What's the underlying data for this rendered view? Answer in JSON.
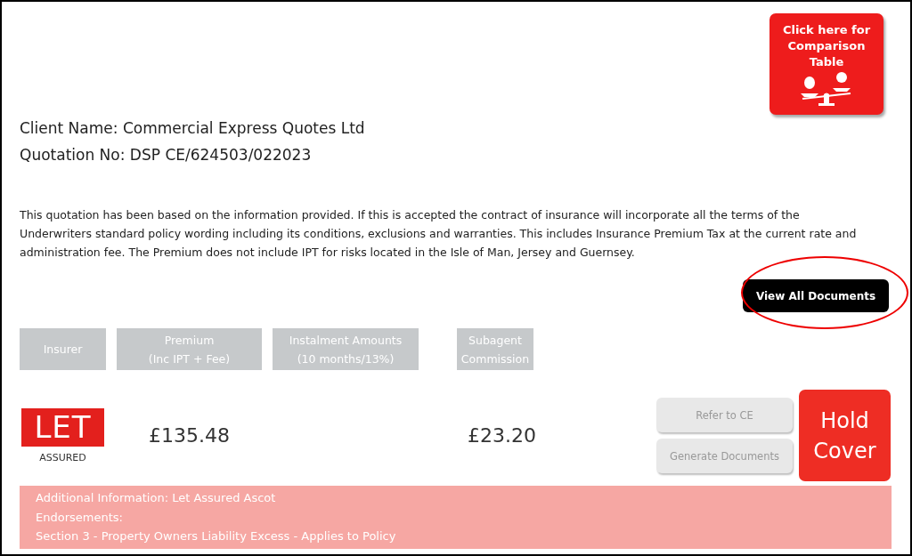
{
  "comparison_button": {
    "label": "Click here for Comparison Table"
  },
  "client_name": "Client Name: Commercial Express Quotes Ltd",
  "quotation_no": "Quotation No: DSP CE/624503/022023",
  "disclaimer": "This quotation has been based on the information provided. If this is accepted the contract of insurance will incorporate all the terms of the Underwriters standard policy wording including its conditions, exclusions and warranties. This includes Insurance Premium Tax at the current rate and administration fee. The Premium does not include IPT for risks located in the Isle of Man, Jersey and Guernsey.",
  "view_all_documents": {
    "label": "View All Documents",
    "highlighted": true
  },
  "table": {
    "columns": [
      {
        "lines": [
          "Insurer"
        ]
      },
      {
        "lines": [
          "Premium",
          "(Inc IPT + Fee)"
        ]
      },
      {
        "lines": [
          "Instalment Amounts",
          "(10 months/13%)"
        ]
      },
      {
        "lines": [
          "Subagent",
          "Commission"
        ]
      }
    ],
    "rows": [
      {
        "insurer_logo": {
          "mark": "LET",
          "tagline": "ASSURED"
        },
        "premium": "£135.48",
        "commission": "£23.20",
        "actions": [
          {
            "label": "Refer to CE",
            "disabled": true
          },
          {
            "label": "Generate Documents",
            "disabled": true
          }
        ],
        "hold_cover": "Hold\nCover",
        "info_lines": [
          "Additional Information:  Let Assured Ascot",
          "Endorsements:",
          "Section 3 - Property Owners Liability Excess - Applies to Policy"
        ]
      }
    ]
  }
}
